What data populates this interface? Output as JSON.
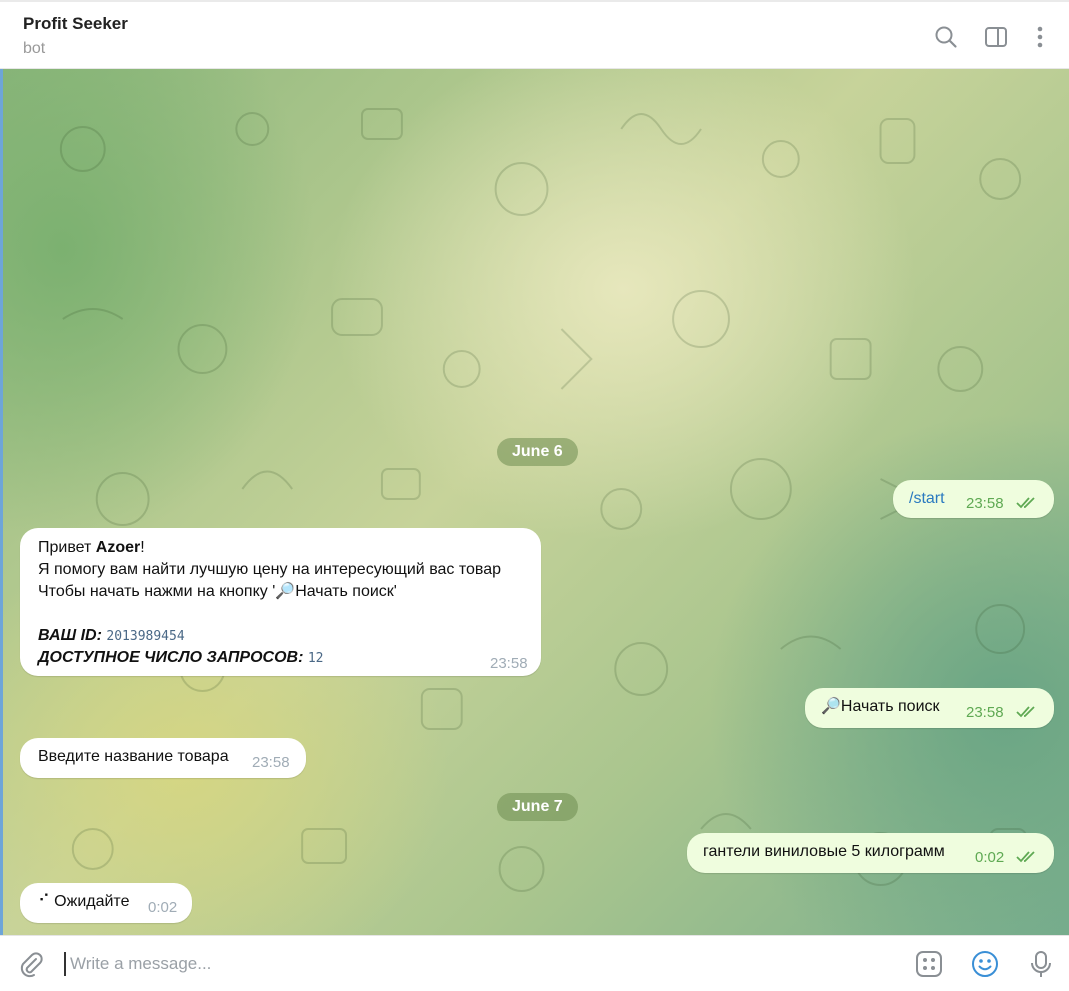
{
  "header": {
    "title": "Profit Seeker",
    "subtitle": "bot"
  },
  "icons": {
    "search": "search-icon",
    "sidebar": "sidebar-toggle-icon",
    "more": "more-vertical-icon",
    "attach": "paperclip-icon",
    "commands": "bot-commands-icon",
    "emoji": "emoji-icon",
    "voice": "microphone-icon"
  },
  "dates": {
    "d1": "June 6",
    "d2": "June 7"
  },
  "messages": {
    "start": {
      "text": "/start",
      "time": "23:58"
    },
    "welcome": {
      "greet_prefix": "Привет ",
      "username": "Azoer",
      "greet_suffix": "!",
      "line2": "Я помогу вам найти лучшую цену на интересующий вас товар",
      "line3": "Чтобы начать нажми на кнопку '🔎Начать поиск'",
      "id_label": "ВАШ ID:",
      "id_value": "2013989454",
      "req_label": "ДОСТУПНОЕ ЧИСЛО ЗАПРОСОВ:",
      "req_value": "12",
      "time": "23:58"
    },
    "search_btn": {
      "text": "🔎Начать поиск",
      "time": "23:58"
    },
    "enter_name": {
      "text": "Введите название товара",
      "time": "23:58"
    },
    "query": {
      "text": "гантели виниловые 5 килограмм",
      "time": "0:02"
    },
    "wait": {
      "text": "⠊ Ожидайте",
      "time": "0:02"
    }
  },
  "composer": {
    "placeholder": "Write a message..."
  },
  "colors": {
    "outgoing_bubble": "#effdde",
    "incoming_bubble": "#ffffff",
    "outgoing_time": "#5fa953",
    "accent": "#3a8fd6"
  }
}
